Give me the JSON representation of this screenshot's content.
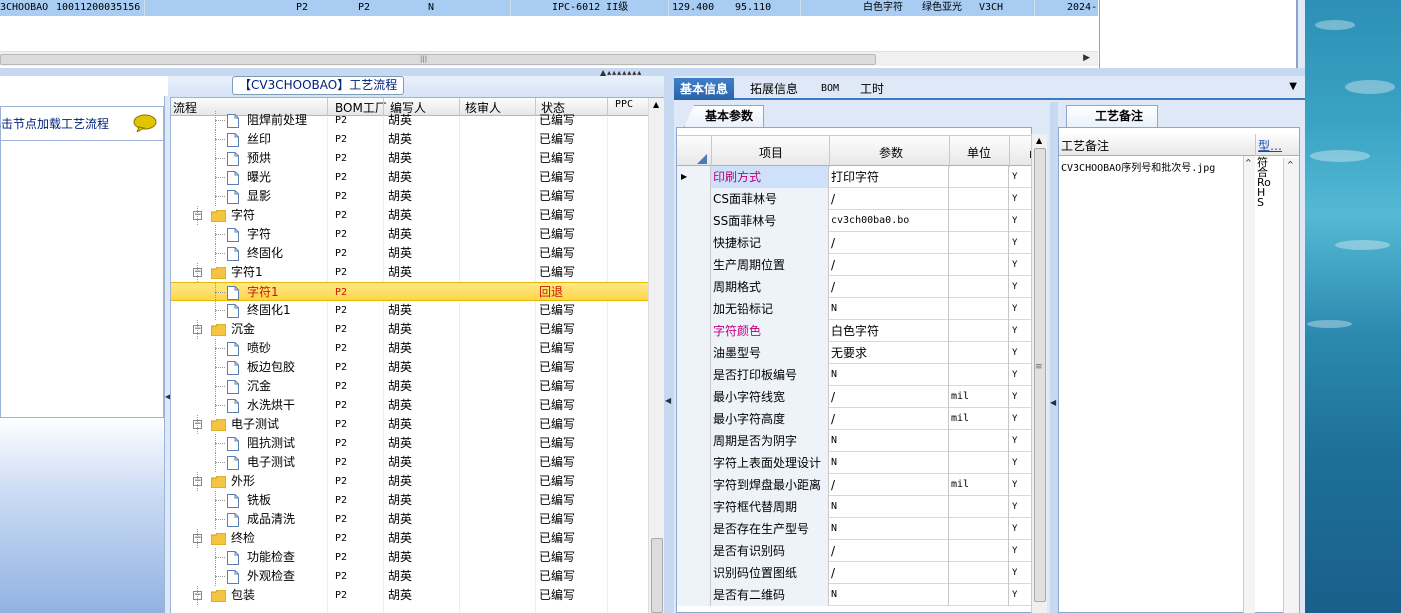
{
  "top_grid": {
    "row": [
      "3CHOOBAO",
      "10011200035156",
      "P2",
      "P2",
      "N",
      "IPC-6012 II级",
      "129.400",
      "95.110",
      "白色字符",
      "绿色亚光",
      "V3CH",
      "2024-"
    ]
  },
  "process_title": "【CV3CHOOBAO】工艺流程",
  "left_note": "单击节点加载工艺流程",
  "tree": {
    "headers": [
      "流程",
      "BOM工厂",
      "编写人",
      "核审人",
      "状态",
      "PPC"
    ],
    "rows": [
      {
        "name": "阻焊前处理",
        "factory": "P2",
        "author": "胡英",
        "reviewer": "",
        "status": "已编写",
        "level": 2,
        "type": "doc"
      },
      {
        "name": "丝印",
        "factory": "P2",
        "author": "胡英",
        "reviewer": "",
        "status": "已编写",
        "level": 2,
        "type": "doc"
      },
      {
        "name": "预烘",
        "factory": "P2",
        "author": "胡英",
        "reviewer": "",
        "status": "已编写",
        "level": 2,
        "type": "doc"
      },
      {
        "name": "曝光",
        "factory": "P2",
        "author": "胡英",
        "reviewer": "",
        "status": "已编写",
        "level": 2,
        "type": "doc"
      },
      {
        "name": "显影",
        "factory": "P2",
        "author": "胡英",
        "reviewer": "",
        "status": "已编写",
        "level": 2,
        "type": "doc"
      },
      {
        "name": "字符",
        "factory": "P2",
        "author": "胡英",
        "reviewer": "",
        "status": "已编写",
        "level": 1,
        "type": "folder"
      },
      {
        "name": "字符",
        "factory": "P2",
        "author": "胡英",
        "reviewer": "",
        "status": "已编写",
        "level": 2,
        "type": "doc"
      },
      {
        "name": "终固化",
        "factory": "P2",
        "author": "胡英",
        "reviewer": "",
        "status": "已编写",
        "level": 2,
        "type": "doc"
      },
      {
        "name": "字符1",
        "factory": "P2",
        "author": "胡英",
        "reviewer": "",
        "status": "已编写",
        "level": 1,
        "type": "folder"
      },
      {
        "name": "字符1",
        "factory": "P2",
        "author": "",
        "reviewer": "",
        "status": "回退",
        "level": 2,
        "type": "doc",
        "selected": true
      },
      {
        "name": "终固化1",
        "factory": "P2",
        "author": "胡英",
        "reviewer": "",
        "status": "已编写",
        "level": 2,
        "type": "doc"
      },
      {
        "name": "沉金",
        "factory": "P2",
        "author": "胡英",
        "reviewer": "",
        "status": "已编写",
        "level": 1,
        "type": "folder"
      },
      {
        "name": "喷砂",
        "factory": "P2",
        "author": "胡英",
        "reviewer": "",
        "status": "已编写",
        "level": 2,
        "type": "doc"
      },
      {
        "name": "板边包胶",
        "factory": "P2",
        "author": "胡英",
        "reviewer": "",
        "status": "已编写",
        "level": 2,
        "type": "doc"
      },
      {
        "name": "沉金",
        "factory": "P2",
        "author": "胡英",
        "reviewer": "",
        "status": "已编写",
        "level": 2,
        "type": "doc"
      },
      {
        "name": "水洗烘干",
        "factory": "P2",
        "author": "胡英",
        "reviewer": "",
        "status": "已编写",
        "level": 2,
        "type": "doc"
      },
      {
        "name": "电子测试",
        "factory": "P2",
        "author": "胡英",
        "reviewer": "",
        "status": "已编写",
        "level": 1,
        "type": "folder"
      },
      {
        "name": "阻抗测试",
        "factory": "P2",
        "author": "胡英",
        "reviewer": "",
        "status": "已编写",
        "level": 2,
        "type": "doc"
      },
      {
        "name": "电子测试",
        "factory": "P2",
        "author": "胡英",
        "reviewer": "",
        "status": "已编写",
        "level": 2,
        "type": "doc"
      },
      {
        "name": "外形",
        "factory": "P2",
        "author": "胡英",
        "reviewer": "",
        "status": "已编写",
        "level": 1,
        "type": "folder"
      },
      {
        "name": "铣板",
        "factory": "P2",
        "author": "胡英",
        "reviewer": "",
        "status": "已编写",
        "level": 2,
        "type": "doc"
      },
      {
        "name": "成品清洗",
        "factory": "P2",
        "author": "胡英",
        "reviewer": "",
        "status": "已编写",
        "level": 2,
        "type": "doc"
      },
      {
        "name": "终检",
        "factory": "P2",
        "author": "胡英",
        "reviewer": "",
        "status": "已编写",
        "level": 1,
        "type": "folder"
      },
      {
        "name": "功能检查",
        "factory": "P2",
        "author": "胡英",
        "reviewer": "",
        "status": "已编写",
        "level": 2,
        "type": "doc"
      },
      {
        "name": "外观检查",
        "factory": "P2",
        "author": "胡英",
        "reviewer": "",
        "status": "已编写",
        "level": 2,
        "type": "doc"
      },
      {
        "name": "包装",
        "factory": "P2",
        "author": "胡英",
        "reviewer": "",
        "status": "已编写",
        "level": 1,
        "type": "folder"
      }
    ]
  },
  "right_tabs": [
    "基本信息",
    "拓展信息",
    "BOM",
    "工时"
  ],
  "param_panel": {
    "tab": "基本参数",
    "headers": [
      "项目",
      "参数",
      "单位"
    ],
    "rows": [
      {
        "item": "印刷方式",
        "value": "打印字符",
        "unit": "",
        "flag": "Y",
        "pink": true,
        "current": true
      },
      {
        "item": "CS面菲林号",
        "value": "/",
        "unit": "",
        "flag": "Y"
      },
      {
        "item": "SS面菲林号",
        "value": "cv3ch00ba0.bo",
        "unit": "",
        "flag": "Y",
        "mono": true
      },
      {
        "item": "快捷标记",
        "value": "/",
        "unit": "",
        "flag": "Y"
      },
      {
        "item": "生产周期位置",
        "value": "/",
        "unit": "",
        "flag": "Y"
      },
      {
        "item": "周期格式",
        "value": "/",
        "unit": "",
        "flag": "Y"
      },
      {
        "item": "加无铅标记",
        "value": "N",
        "unit": "",
        "flag": "Y",
        "mono": true
      },
      {
        "item": "字符颜色",
        "value": "白色字符",
        "unit": "",
        "flag": "Y",
        "pink": true
      },
      {
        "item": "油墨型号",
        "value": "无要求",
        "unit": "",
        "flag": "Y"
      },
      {
        "item": "是否打印板编号",
        "value": "N",
        "unit": "",
        "flag": "Y",
        "mono": true
      },
      {
        "item": "最小字符线宽",
        "value": "/",
        "unit": "mil",
        "flag": "Y"
      },
      {
        "item": "最小字符高度",
        "value": "/",
        "unit": "mil",
        "flag": "Y"
      },
      {
        "item": "周期是否为阴字",
        "value": "N",
        "unit": "",
        "flag": "Y",
        "mono": true
      },
      {
        "item": "字符上表面处理设计",
        "value": "N",
        "unit": "",
        "flag": "Y",
        "mono": true
      },
      {
        "item": "字符到焊盘最小距离",
        "value": "/",
        "unit": "mil",
        "flag": "Y"
      },
      {
        "item": "字符框代替周期",
        "value": "N",
        "unit": "",
        "flag": "Y",
        "mono": true
      },
      {
        "item": "是否存在生产型号",
        "value": "N",
        "unit": "",
        "flag": "Y",
        "mono": true
      },
      {
        "item": "是否有识别码",
        "value": "/",
        "unit": "",
        "flag": "Y"
      },
      {
        "item": "识别码位置图纸",
        "value": "/",
        "unit": "",
        "flag": "Y"
      },
      {
        "item": "是否有二维码",
        "value": "N",
        "unit": "",
        "flag": "Y",
        "mono": true
      }
    ]
  },
  "note_panel": {
    "tab": "工艺备注",
    "headers": [
      "工艺备注",
      "型…"
    ],
    "cell": "CV3CHOOBAO序列号和批次号.jpg",
    "type_text": "符合RoHS"
  },
  "colors": {
    "selected_row": "#ffd74a",
    "pink_item": "#c0007e",
    "tab_active": "#2a63a8"
  }
}
